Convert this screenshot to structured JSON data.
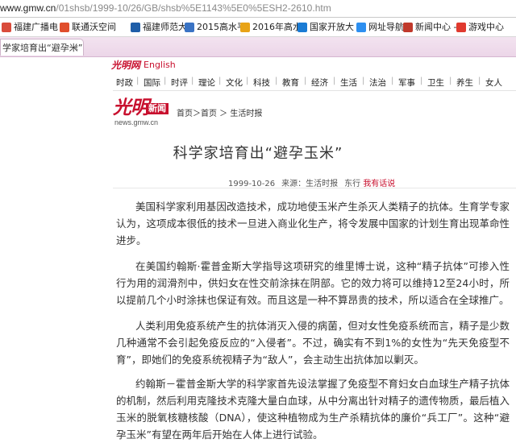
{
  "browser": {
    "url_host": "www.gmw.cn",
    "url_path": "/01shsb/1999-10/26/GB/shsb%5E1143%5E0%5ESH2-2610.htm",
    "bookmarks": [
      {
        "label": "福建广播电",
        "color": "#d94b3b"
      },
      {
        "label": "联通沃空间",
        "color": "#e04e2c"
      },
      {
        "label": "福建师范大",
        "color": "#1f5ea8"
      },
      {
        "label": "2015高水平",
        "color": "#3a73c4"
      },
      {
        "label": "2016年高水",
        "color": "#e8a317"
      },
      {
        "label": "国家开放大",
        "color": "#1a7bd4"
      },
      {
        "label": "网址导航",
        "color": "#2d8ff0"
      },
      {
        "label": "新闻中心 -",
        "color": "#c0392b"
      },
      {
        "label": "游戏中心",
        "color": "#e03a2f"
      }
    ],
    "tab_title": "学家培育出“避孕米”"
  },
  "site": {
    "logo_mark": "光明网",
    "logo_en": "English",
    "nav": [
      "时政",
      "国际",
      "时评",
      "理论",
      "文化",
      "科技",
      "教育",
      "经济",
      "生活",
      "法治",
      "军事",
      "卫生",
      "养生",
      "女人"
    ],
    "brand_big": "光明",
    "brand_news": "新闻",
    "brand_domain": "news.gmw.cn",
    "breadcrumb": "首页＞首页 ＞ 生活时报"
  },
  "article": {
    "title": "科学家培育出“避孕玉米”",
    "date": "1999-10-26",
    "source": "来源：生活时报",
    "author": "东行",
    "report_link": "我有话说",
    "paragraphs": [
      "美国科学家利用基因改造技术，成功地使玉米产生杀灭人类精子的抗体。生育学专家认为，这项成本很低的技术一旦进入商业化生产，将令发展中国家的计划生育出现革命性进步。",
      "在美国约翰斯·霍普金斯大学指导这项研究的维里博士说，这种“精子抗体”可掺入性行为用的润滑剂中，供妇女在性交前涂抹在阴部。它的效力将可以维持12至24小时，所以提前几个小时涂抹也保证有效。而且这是一种不算昂贵的技术，所以适合在全球推广。",
      "人类利用免疫系统产生的抗体消灭入侵的病菌，但对女性免疫系统而言，精子是少数几种通常不会引起免疫反应的“入侵者”。不过，确实有不到1%的女性为“先天免疫型不育”，即她们的免疫系统视精子为“敌人”，会主动生出抗体加以剿灭。",
      "约翰斯－霍普金斯大学的科学家首先设法掌握了免疫型不育妇女白血球生产精子抗体的机制，然后利用克隆技术克隆大量白血球，从中分离出针对精子的遗传物质，最后植入玉米的脱氧核糖核酸（DNA），使这种植物成为生产杀精抗体的廉价“兵工厂”。这种“避孕玉米”有望在两年后开始在人体上进行试验。"
    ]
  }
}
